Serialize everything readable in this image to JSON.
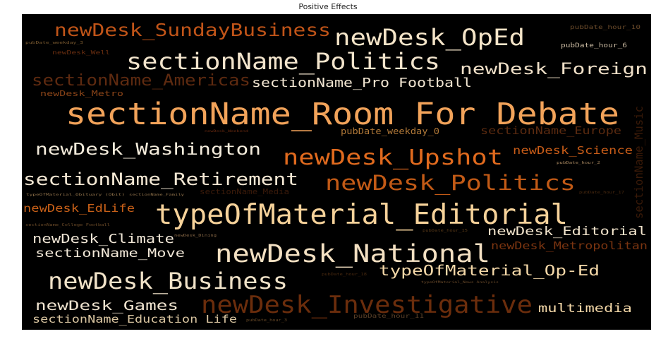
{
  "title": "Positive Effects",
  "chart_data": {
    "type": "wordcloud",
    "title": "Positive Effects",
    "background": "#000000",
    "colormap": "copper",
    "words": [
      {
        "text": "sectionName_Room For Debate",
        "color": "#f2a35a",
        "emphasis": 1.0
      },
      {
        "text": "typeOfMaterial_Editorial",
        "color": "#f6d29a",
        "emphasis": 0.92
      },
      {
        "text": "newDesk_National",
        "color": "#f3e0c2",
        "emphasis": 0.85
      },
      {
        "text": "newDesk_Investigative",
        "color": "#6b2d0c",
        "emphasis": 0.8
      },
      {
        "text": "sectionName_Politics",
        "color": "#f2e4cc",
        "emphasis": 0.78
      },
      {
        "text": "newDesk_Business",
        "color": "#f0e2c8",
        "emphasis": 0.76
      },
      {
        "text": "newDesk_OpEd",
        "color": "#f4e4c8",
        "emphasis": 0.74
      },
      {
        "text": "newDesk_Upshot",
        "color": "#e06a1e",
        "emphasis": 0.7
      },
      {
        "text": "newDesk_Politics",
        "color": "#c25a16",
        "emphasis": 0.66
      },
      {
        "text": "newDesk_SundayBusiness",
        "color": "#c05418",
        "emphasis": 0.6
      },
      {
        "text": "sectionName_Retirement",
        "color": "#f4e8d4",
        "emphasis": 0.58
      },
      {
        "text": "newDesk_Washington",
        "color": "#f4ecdc",
        "emphasis": 0.52
      },
      {
        "text": "sectionName_Americas",
        "color": "#5e2a10",
        "emphasis": 0.5
      },
      {
        "text": "newDesk_Foreign",
        "color": "#f0e0c8",
        "emphasis": 0.5
      },
      {
        "text": "typeOfMaterial_Op-Ed",
        "color": "#f4d8a8",
        "emphasis": 0.46
      },
      {
        "text": "newDesk_Games",
        "color": "#f0e4d0",
        "emphasis": 0.42
      },
      {
        "text": "sectionName_Pro Football",
        "color": "#f2e6d2",
        "emphasis": 0.4
      },
      {
        "text": "newDesk_Climate",
        "color": "#f0e6d6",
        "emphasis": 0.38
      },
      {
        "text": "multimedia",
        "color": "#f4d8a8",
        "emphasis": 0.36
      },
      {
        "text": "sectionName_Move",
        "color": "#f2e8d8",
        "emphasis": 0.36
      },
      {
        "text": "sectionName_Education Life",
        "color": "#d8c4a0",
        "emphasis": 0.34
      },
      {
        "text": "sectionName_Music",
        "color": "#3a1a08",
        "emphasis": 0.34
      },
      {
        "text": "newDesk_Editorial",
        "color": "#f2e4cc",
        "emphasis": 0.32
      },
      {
        "text": "newDesk_EdLife",
        "color": "#c86018",
        "emphasis": 0.32
      },
      {
        "text": "sectionName_Europe",
        "color": "#5a2a10",
        "emphasis": 0.3
      },
      {
        "text": "newDesk_Science",
        "color": "#c85c18",
        "emphasis": 0.3
      },
      {
        "text": "newDesk_Metropolitan",
        "color": "#7a3410",
        "emphasis": 0.3
      },
      {
        "text": "pubDate_weekday_0",
        "color": "#b07838",
        "emphasis": 0.26
      },
      {
        "text": "sectionName_Media",
        "color": "#3a1a0a",
        "emphasis": 0.22
      },
      {
        "text": "newDesk_Metro",
        "color": "#8a4418",
        "emphasis": 0.2
      },
      {
        "text": "pubDate_hour_6",
        "color": "#c8b8a0",
        "emphasis": 0.18
      },
      {
        "text": "pubDate_hour_10",
        "color": "#6a4a2a",
        "emphasis": 0.16
      },
      {
        "text": "pubDate_hour_11",
        "color": "#5a4028",
        "emphasis": 0.16
      },
      {
        "text": "newDesk_Well",
        "color": "#6a2e10",
        "emphasis": 0.14
      },
      {
        "text": "pubDate_weekday_3",
        "color": "#7a5a30",
        "emphasis": 0.1
      },
      {
        "text": "pubDate_hour_2",
        "color": "#a88860",
        "emphasis": 0.1
      },
      {
        "text": "pubDate_hour_17",
        "color": "#4a2a10",
        "emphasis": 0.1
      },
      {
        "text": "pubDate_hour_15",
        "color": "#5a3a18",
        "emphasis": 0.1
      },
      {
        "text": "pubDate_hour_18",
        "color": "#4a2a10",
        "emphasis": 0.1
      },
      {
        "text": "pubDate_hour_3",
        "color": "#6a4a28",
        "emphasis": 0.1
      },
      {
        "text": "newDesk_Dining",
        "color": "#8a6a48",
        "emphasis": 0.08
      },
      {
        "text": "newDesk_Weekend",
        "color": "#6a2a10",
        "emphasis": 0.08
      },
      {
        "text": "sectionName_College Football",
        "color": "#6a4a28",
        "emphasis": 0.08
      },
      {
        "text": "typeOfMaterial_Obituary (Obit)",
        "color": "#9a7a50",
        "emphasis": 0.08
      },
      {
        "text": "sectionName_Family",
        "color": "#9a7a50",
        "emphasis": 0.08
      },
      {
        "text": "typeOfMaterial_News Analysis",
        "color": "#6a4a2a",
        "emphasis": 0.08
      }
    ]
  }
}
